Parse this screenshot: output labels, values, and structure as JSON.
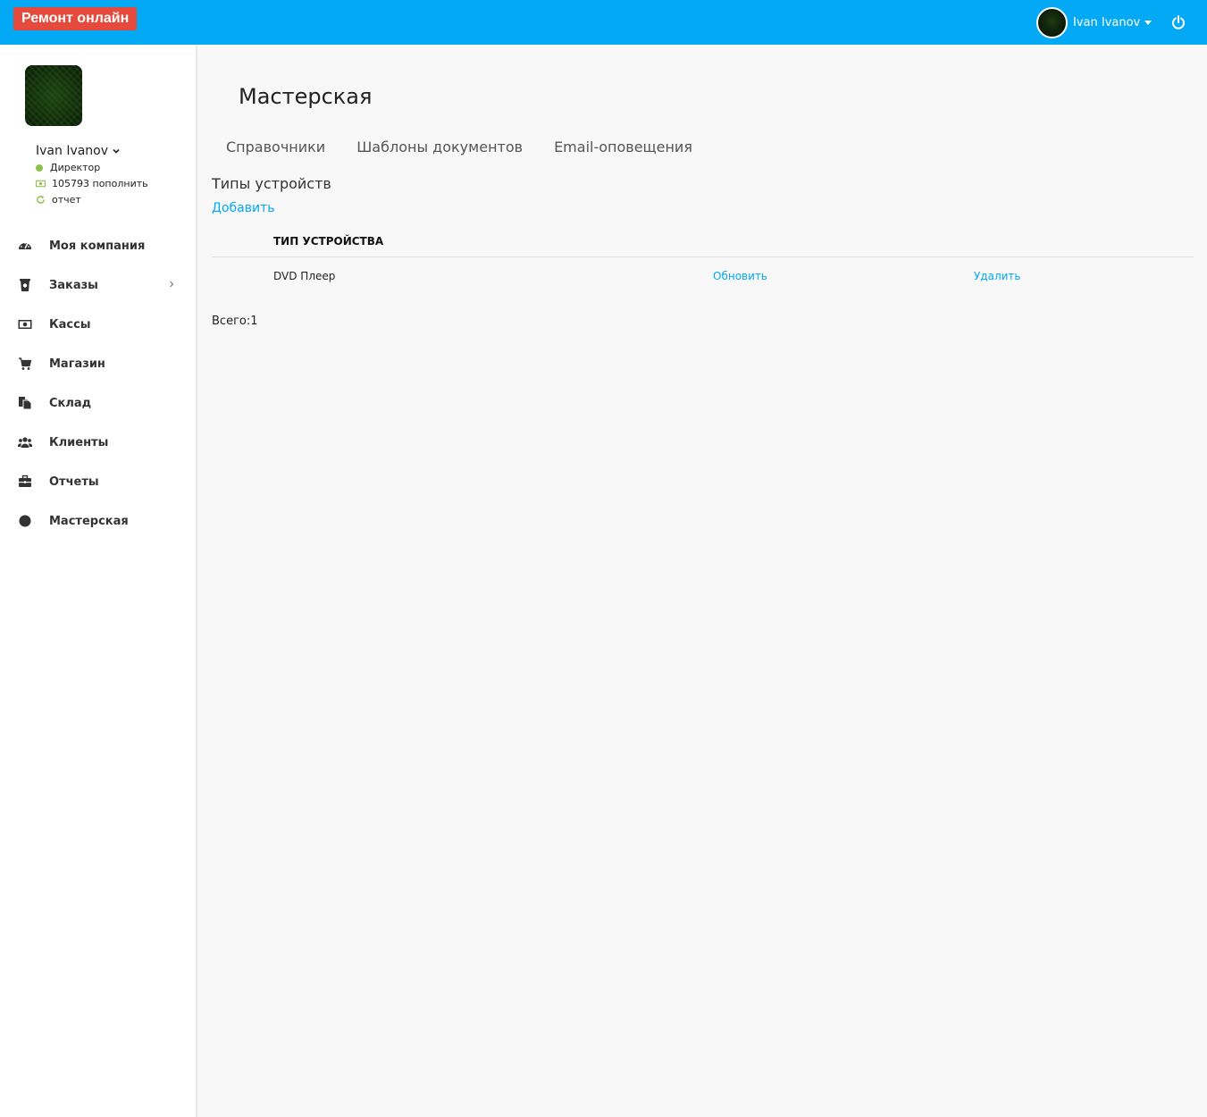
{
  "header": {
    "brand": "Ремонт онлайн",
    "user_name": "Ivan Ivanov",
    "accent_color": "#03a9f4",
    "brand_color": "#e64a3c",
    "icons": [
      "avatar",
      "caret-down-icon",
      "power-icon"
    ]
  },
  "sidebar": {
    "user_name": "Ivan Ivanov",
    "role": "Директор",
    "balance": "105793",
    "topup": "пополнить",
    "report": "отчет",
    "items": [
      {
        "label": "Моя компания",
        "icon": "dashboard-icon"
      },
      {
        "label": "Заказы",
        "icon": "orders-icon",
        "has_submenu": true
      },
      {
        "label": "Кассы",
        "icon": "money-icon"
      },
      {
        "label": "Магазин",
        "icon": "cart-icon"
      },
      {
        "label": "Склад",
        "icon": "copy-icon"
      },
      {
        "label": "Клиенты",
        "icon": "users-icon"
      },
      {
        "label": "Отчеты",
        "icon": "briefcase-icon"
      },
      {
        "label": "Мастерская",
        "icon": "circle-icon"
      }
    ]
  },
  "main": {
    "title": "Мастерская",
    "tabs": [
      "Справочники",
      "Шаблоны документов",
      "Email-оповещения"
    ],
    "section_title": "Типы устройств",
    "add_label": "Добавить",
    "table": {
      "column": "ТИП УСТРОЙСТВА",
      "rows": [
        {
          "name": "DVD Плеер",
          "update": "Обновить",
          "delete": "Удалить"
        }
      ]
    },
    "total": "Всего:1"
  }
}
